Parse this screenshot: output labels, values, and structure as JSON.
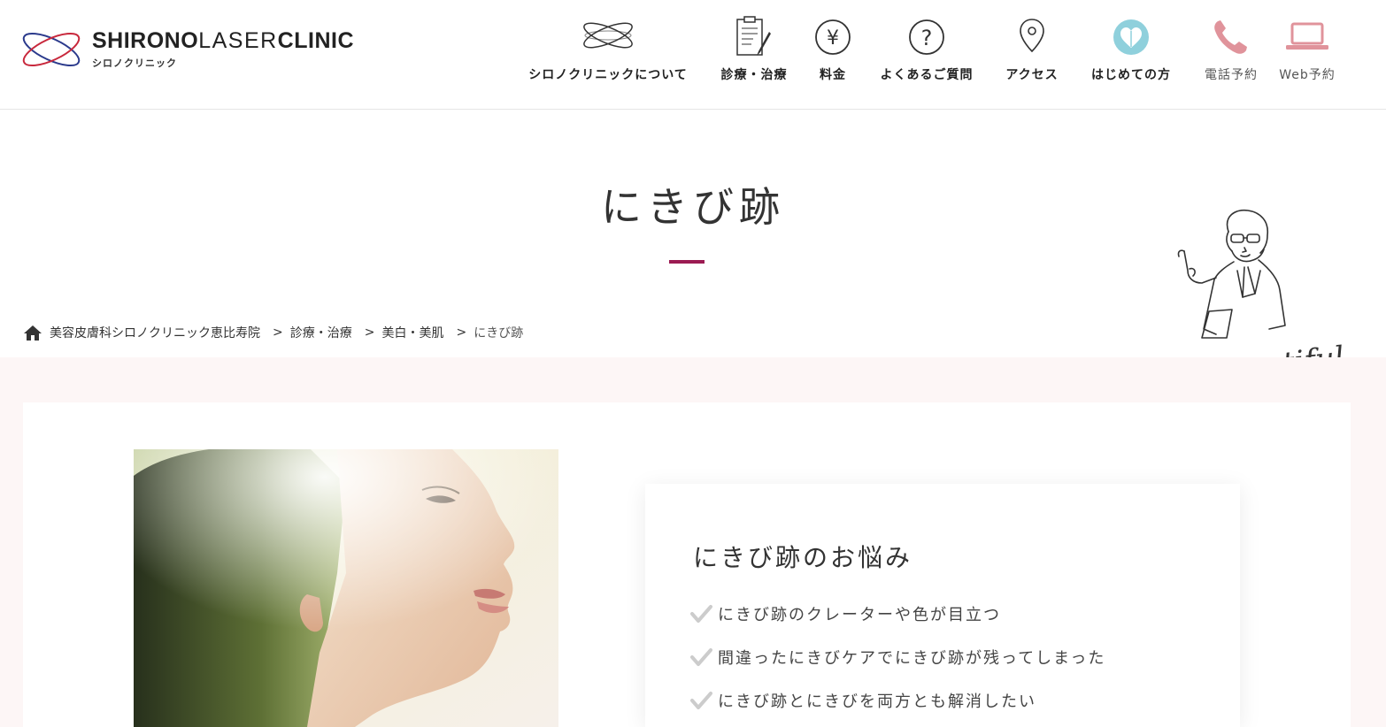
{
  "header": {
    "logo": {
      "word1": "SHIRONO",
      "word2": "LASER",
      "word3": "CLINIC",
      "sub": "シロノクリニック"
    },
    "nav": [
      {
        "label": "シロノクリニックについて",
        "icon": "clinic-logo-icon"
      },
      {
        "label": "診療・治療",
        "icon": "clipboard-pen-icon"
      },
      {
        "label": "料金",
        "icon": "yen-icon"
      },
      {
        "label": "よくあるご質問",
        "icon": "question-icon"
      },
      {
        "label": "アクセス",
        "icon": "map-pin-icon"
      },
      {
        "label": "はじめての方",
        "icon": "heart-icon"
      },
      {
        "label": "電話予約",
        "icon": "phone-icon"
      },
      {
        "label": "Web予約",
        "icon": "laptop-icon"
      }
    ]
  },
  "page": {
    "title": "にきび跡"
  },
  "breadcrumb": {
    "items": [
      "美容皮膚科シロノクリニック恵比寿院",
      "診療・治療",
      "美白・美肌"
    ],
    "current": "にきび跡",
    "separator": ">"
  },
  "mascot": {
    "caption": "Be beautiful!"
  },
  "worries": {
    "title": "にきび跡のお悩み",
    "items": [
      "にきび跡のクレーターや色が目立つ",
      "間違ったにきびケアでにきび跡が残ってしまった",
      "にきび跡とにきびを両方とも解消したい"
    ]
  },
  "colors": {
    "accent": "#9b1b52",
    "phone": "#e0939b",
    "heart": "#8fd0dc",
    "band": "#fdf6f6"
  }
}
